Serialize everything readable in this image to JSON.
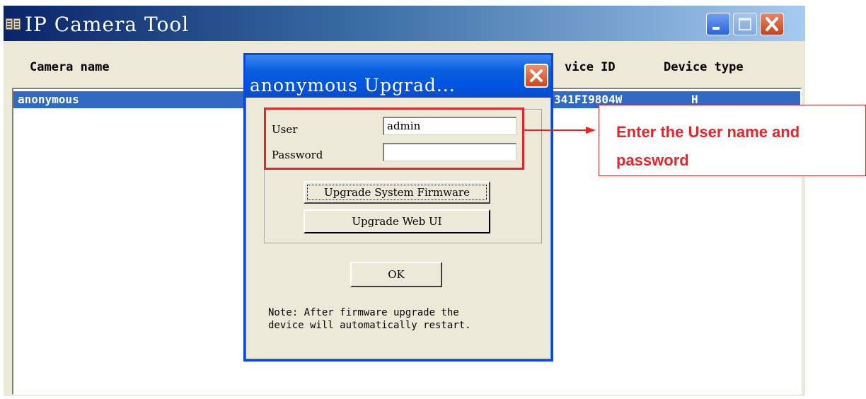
{
  "window": {
    "title": "IP Camera Tool",
    "icon": "app-icon"
  },
  "columns": {
    "camera_name": "Camera name",
    "device_id": "vice ID",
    "device_type": "Device type"
  },
  "list": {
    "rows": [
      {
        "camera_name": "anonymous",
        "device_id": "341FI9804W",
        "device_type": "H",
        "selected": true
      }
    ]
  },
  "dialog": {
    "title": "anonymous Upgrad...",
    "user_label": "User",
    "user_value": "admin",
    "password_label": "Password",
    "password_value": "",
    "upgrade_firmware_label": "Upgrade System Firmware",
    "upgrade_webui_label": "Upgrade Web UI",
    "ok_label": "OK",
    "note": "Note: After firmware upgrade the\ndevice will automatically restart."
  },
  "annotation": {
    "text": "Enter the User name and password",
    "color": "#e4252a"
  },
  "colors": {
    "selection": "#316ac5",
    "titlebar": "#0054e3",
    "window_bg": "#ece9d8"
  }
}
